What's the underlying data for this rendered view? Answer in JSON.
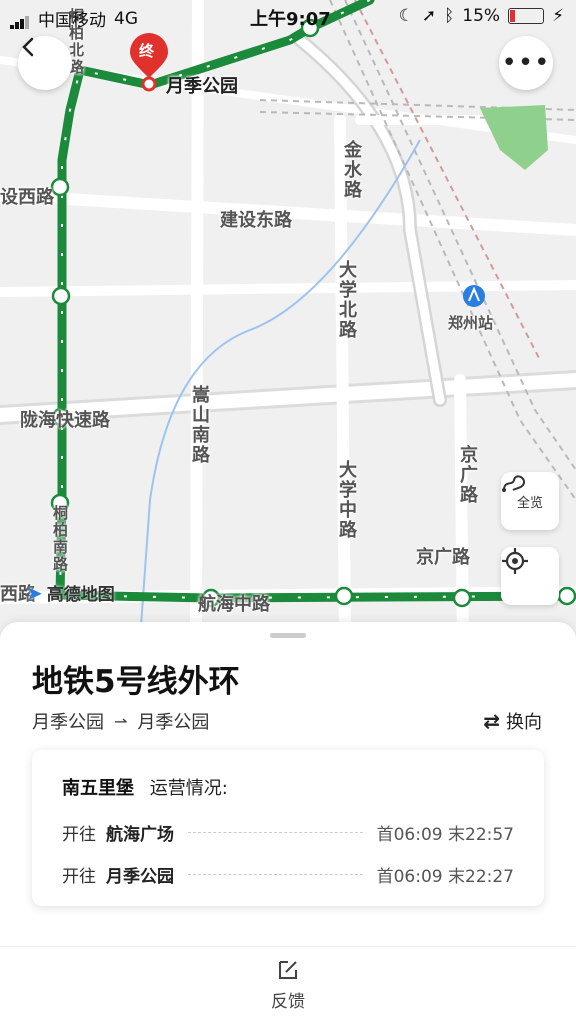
{
  "status_bar": {
    "carrier": "中国移动",
    "network": "4G",
    "time": "上午9:07",
    "battery": "15%"
  },
  "map": {
    "end_marker": "终",
    "roads": [
      "月季公园",
      "设西路",
      "建设东路",
      "金水路",
      "大学北路",
      "陇海快速路",
      "嵩山南路",
      "大学中路",
      "京广路",
      "京广路",
      "西路",
      "航海中路",
      "郑州站",
      "桐柏北路",
      "桐柏南路"
    ],
    "logo": "高德地图",
    "overview_label": "全览"
  },
  "panel": {
    "line_name": "地铁5号线外环",
    "from": "月季公园",
    "to": "月季公园",
    "switch_label": "换向",
    "station": "南五里堡",
    "operation_label": "运营情况:",
    "directions": [
      {
        "prefix": "开往",
        "dest": "航海广场",
        "times": "首06:09 末22:57"
      },
      {
        "prefix": "开往",
        "dest": "月季公园",
        "times": "首06:09 末22:27"
      }
    ],
    "feedback_label": "反馈"
  },
  "colors": {
    "route": "#1b8a3a",
    "accent": "#e0312d",
    "station_icon": "#2a7de1"
  }
}
